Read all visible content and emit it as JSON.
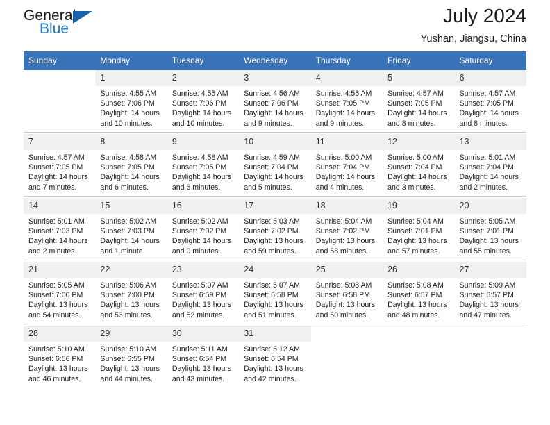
{
  "logo": {
    "word_top": "General",
    "word_bottom": "Blue",
    "triangle_color": "#1764ad"
  },
  "header": {
    "title": "July 2024",
    "subtitle": "Yushan, Jiangsu, China",
    "accent_color": "#3a72b8",
    "daynum_band_color": "#f0f0f0"
  },
  "weekday_headers": [
    "Sunday",
    "Monday",
    "Tuesday",
    "Wednesday",
    "Thursday",
    "Friday",
    "Saturday"
  ],
  "weeks": [
    [
      {
        "day": "",
        "sunrise": "",
        "sunset": "",
        "daylight1": "",
        "daylight2": "",
        "empty": true
      },
      {
        "day": "1",
        "sunrise": "Sunrise: 4:55 AM",
        "sunset": "Sunset: 7:06 PM",
        "daylight1": "Daylight: 14 hours",
        "daylight2": "and 10 minutes.",
        "empty": false
      },
      {
        "day": "2",
        "sunrise": "Sunrise: 4:55 AM",
        "sunset": "Sunset: 7:06 PM",
        "daylight1": "Daylight: 14 hours",
        "daylight2": "and 10 minutes.",
        "empty": false
      },
      {
        "day": "3",
        "sunrise": "Sunrise: 4:56 AM",
        "sunset": "Sunset: 7:06 PM",
        "daylight1": "Daylight: 14 hours",
        "daylight2": "and 9 minutes.",
        "empty": false
      },
      {
        "day": "4",
        "sunrise": "Sunrise: 4:56 AM",
        "sunset": "Sunset: 7:05 PM",
        "daylight1": "Daylight: 14 hours",
        "daylight2": "and 9 minutes.",
        "empty": false
      },
      {
        "day": "5",
        "sunrise": "Sunrise: 4:57 AM",
        "sunset": "Sunset: 7:05 PM",
        "daylight1": "Daylight: 14 hours",
        "daylight2": "and 8 minutes.",
        "empty": false
      },
      {
        "day": "6",
        "sunrise": "Sunrise: 4:57 AM",
        "sunset": "Sunset: 7:05 PM",
        "daylight1": "Daylight: 14 hours",
        "daylight2": "and 8 minutes.",
        "empty": false
      }
    ],
    [
      {
        "day": "7",
        "sunrise": "Sunrise: 4:57 AM",
        "sunset": "Sunset: 7:05 PM",
        "daylight1": "Daylight: 14 hours",
        "daylight2": "and 7 minutes.",
        "empty": false
      },
      {
        "day": "8",
        "sunrise": "Sunrise: 4:58 AM",
        "sunset": "Sunset: 7:05 PM",
        "daylight1": "Daylight: 14 hours",
        "daylight2": "and 6 minutes.",
        "empty": false
      },
      {
        "day": "9",
        "sunrise": "Sunrise: 4:58 AM",
        "sunset": "Sunset: 7:05 PM",
        "daylight1": "Daylight: 14 hours",
        "daylight2": "and 6 minutes.",
        "empty": false
      },
      {
        "day": "10",
        "sunrise": "Sunrise: 4:59 AM",
        "sunset": "Sunset: 7:04 PM",
        "daylight1": "Daylight: 14 hours",
        "daylight2": "and 5 minutes.",
        "empty": false
      },
      {
        "day": "11",
        "sunrise": "Sunrise: 5:00 AM",
        "sunset": "Sunset: 7:04 PM",
        "daylight1": "Daylight: 14 hours",
        "daylight2": "and 4 minutes.",
        "empty": false
      },
      {
        "day": "12",
        "sunrise": "Sunrise: 5:00 AM",
        "sunset": "Sunset: 7:04 PM",
        "daylight1": "Daylight: 14 hours",
        "daylight2": "and 3 minutes.",
        "empty": false
      },
      {
        "day": "13",
        "sunrise": "Sunrise: 5:01 AM",
        "sunset": "Sunset: 7:04 PM",
        "daylight1": "Daylight: 14 hours",
        "daylight2": "and 2 minutes.",
        "empty": false
      }
    ],
    [
      {
        "day": "14",
        "sunrise": "Sunrise: 5:01 AM",
        "sunset": "Sunset: 7:03 PM",
        "daylight1": "Daylight: 14 hours",
        "daylight2": "and 2 minutes.",
        "empty": false
      },
      {
        "day": "15",
        "sunrise": "Sunrise: 5:02 AM",
        "sunset": "Sunset: 7:03 PM",
        "daylight1": "Daylight: 14 hours",
        "daylight2": "and 1 minute.",
        "empty": false
      },
      {
        "day": "16",
        "sunrise": "Sunrise: 5:02 AM",
        "sunset": "Sunset: 7:02 PM",
        "daylight1": "Daylight: 14 hours",
        "daylight2": "and 0 minutes.",
        "empty": false
      },
      {
        "day": "17",
        "sunrise": "Sunrise: 5:03 AM",
        "sunset": "Sunset: 7:02 PM",
        "daylight1": "Daylight: 13 hours",
        "daylight2": "and 59 minutes.",
        "empty": false
      },
      {
        "day": "18",
        "sunrise": "Sunrise: 5:04 AM",
        "sunset": "Sunset: 7:02 PM",
        "daylight1": "Daylight: 13 hours",
        "daylight2": "and 58 minutes.",
        "empty": false
      },
      {
        "day": "19",
        "sunrise": "Sunrise: 5:04 AM",
        "sunset": "Sunset: 7:01 PM",
        "daylight1": "Daylight: 13 hours",
        "daylight2": "and 57 minutes.",
        "empty": false
      },
      {
        "day": "20",
        "sunrise": "Sunrise: 5:05 AM",
        "sunset": "Sunset: 7:01 PM",
        "daylight1": "Daylight: 13 hours",
        "daylight2": "and 55 minutes.",
        "empty": false
      }
    ],
    [
      {
        "day": "21",
        "sunrise": "Sunrise: 5:05 AM",
        "sunset": "Sunset: 7:00 PM",
        "daylight1": "Daylight: 13 hours",
        "daylight2": "and 54 minutes.",
        "empty": false
      },
      {
        "day": "22",
        "sunrise": "Sunrise: 5:06 AM",
        "sunset": "Sunset: 7:00 PM",
        "daylight1": "Daylight: 13 hours",
        "daylight2": "and 53 minutes.",
        "empty": false
      },
      {
        "day": "23",
        "sunrise": "Sunrise: 5:07 AM",
        "sunset": "Sunset: 6:59 PM",
        "daylight1": "Daylight: 13 hours",
        "daylight2": "and 52 minutes.",
        "empty": false
      },
      {
        "day": "24",
        "sunrise": "Sunrise: 5:07 AM",
        "sunset": "Sunset: 6:58 PM",
        "daylight1": "Daylight: 13 hours",
        "daylight2": "and 51 minutes.",
        "empty": false
      },
      {
        "day": "25",
        "sunrise": "Sunrise: 5:08 AM",
        "sunset": "Sunset: 6:58 PM",
        "daylight1": "Daylight: 13 hours",
        "daylight2": "and 50 minutes.",
        "empty": false
      },
      {
        "day": "26",
        "sunrise": "Sunrise: 5:08 AM",
        "sunset": "Sunset: 6:57 PM",
        "daylight1": "Daylight: 13 hours",
        "daylight2": "and 48 minutes.",
        "empty": false
      },
      {
        "day": "27",
        "sunrise": "Sunrise: 5:09 AM",
        "sunset": "Sunset: 6:57 PM",
        "daylight1": "Daylight: 13 hours",
        "daylight2": "and 47 minutes.",
        "empty": false
      }
    ],
    [
      {
        "day": "28",
        "sunrise": "Sunrise: 5:10 AM",
        "sunset": "Sunset: 6:56 PM",
        "daylight1": "Daylight: 13 hours",
        "daylight2": "and 46 minutes.",
        "empty": false
      },
      {
        "day": "29",
        "sunrise": "Sunrise: 5:10 AM",
        "sunset": "Sunset: 6:55 PM",
        "daylight1": "Daylight: 13 hours",
        "daylight2": "and 44 minutes.",
        "empty": false
      },
      {
        "day": "30",
        "sunrise": "Sunrise: 5:11 AM",
        "sunset": "Sunset: 6:54 PM",
        "daylight1": "Daylight: 13 hours",
        "daylight2": "and 43 minutes.",
        "empty": false
      },
      {
        "day": "31",
        "sunrise": "Sunrise: 5:12 AM",
        "sunset": "Sunset: 6:54 PM",
        "daylight1": "Daylight: 13 hours",
        "daylight2": "and 42 minutes.",
        "empty": false
      },
      {
        "day": "",
        "sunrise": "",
        "sunset": "",
        "daylight1": "",
        "daylight2": "",
        "empty": true
      },
      {
        "day": "",
        "sunrise": "",
        "sunset": "",
        "daylight1": "",
        "daylight2": "",
        "empty": true
      },
      {
        "day": "",
        "sunrise": "",
        "sunset": "",
        "daylight1": "",
        "daylight2": "",
        "empty": true
      }
    ]
  ]
}
